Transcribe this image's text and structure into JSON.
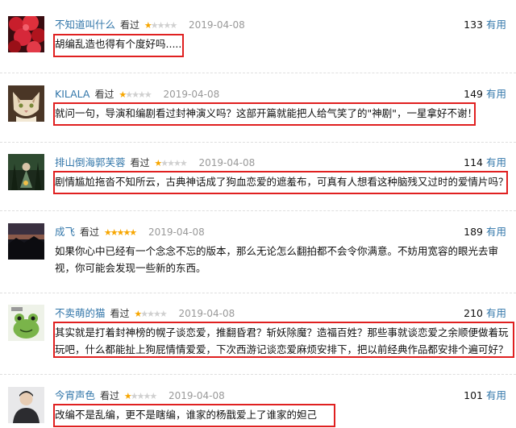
{
  "colors": {
    "username": "#3377aa",
    "star_on": "#f7a600",
    "star_off": "#d0d0d0",
    "date": "#999999",
    "highlight_box": "#e02020"
  },
  "reviews": [
    {
      "user": "不知道叫什么",
      "watched": "看过",
      "stars": 1,
      "date": "2019-04-08",
      "useful_count": "133",
      "useful_label": "有用",
      "comment": "胡编乱造也得有个度好吗.....",
      "highlighted": true,
      "avatar": "red-flowers-avatar"
    },
    {
      "user": "KILALA",
      "watched": "看过",
      "stars": 1,
      "date": "2019-04-08",
      "useful_count": "149",
      "useful_label": "有用",
      "comment": "就问一句，导演和编剧看过封神演义吗？这部开篇就能把人给气笑了的\"神剧\"，一星拿好不谢！",
      "highlighted": true,
      "avatar": "cat-avatar"
    },
    {
      "user": "排山倒海郭芙蓉",
      "watched": "看过",
      "stars": 1,
      "date": "2019-04-08",
      "useful_count": "114",
      "useful_label": "有用",
      "comment": "剧情尴尬拖沓不知所云，古典神话成了狗血恋爱的遮羞布，可真有人想看这种脑残又过时的爱情片吗？",
      "highlighted": true,
      "avatar": "forest-figure-avatar"
    },
    {
      "user": "成飞",
      "watched": "看过",
      "stars": 5,
      "date": "2019-04-08",
      "useful_count": "189",
      "useful_label": "有用",
      "comment_lines": [
        "如果你心中已经有一个念念不忘的版本，那么无论怎么翻拍都不会令你满意。不妨用宽容的眼光去审",
        "视，你可能会发现一些新的东西。"
      ],
      "highlighted": false,
      "avatar": "dark-sunset-avatar"
    },
    {
      "user": "不卖萌的猫",
      "watched": "看过",
      "stars": 1,
      "date": "2019-04-08",
      "useful_count": "210",
      "useful_label": "有用",
      "comment_lines": [
        "其实就是打着封神榜的幌子谈恋爱，推翻昏君？斩妖除魔？造福百姓？那些事就谈恋爱之余顺便做着玩",
        "玩吧，什么都能扯上狗屁情情爱爱，下次西游记谈恋爱麻烦安排下，把以前经典作品都安排个遍可好？"
      ],
      "highlighted": true,
      "avatar": "frog-cartoon-avatar"
    },
    {
      "user": "今宵声色",
      "watched": "看过",
      "stars": 1,
      "date": "2019-04-08",
      "useful_count": "101",
      "useful_label": "有用",
      "comment": "改编不是乱编，更不是瞎编，谁家的杨戬爱上了谁家的妲己",
      "highlighted": true,
      "avatar": "person-portrait-avatar"
    }
  ]
}
